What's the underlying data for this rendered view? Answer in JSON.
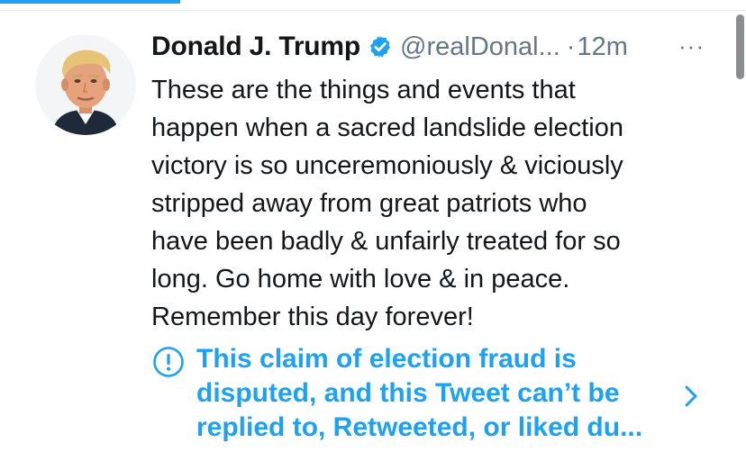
{
  "colors": {
    "accent": "#1da1f2",
    "text": "#14171a",
    "secondary_text": "#657786"
  },
  "tweet": {
    "author": {
      "display_name": "Donald J. Trump",
      "handle": "@realDonal...",
      "verified_icon": "verified-badge-icon",
      "avatar": "profile-photo"
    },
    "separator": "·",
    "timestamp": "12m",
    "more_label": "···",
    "text_lines": [
      "These are the things and events that",
      "happen when a sacred landslide election",
      "victory is so unceremoniously & viciously",
      "stripped away from great patriots who",
      "have been badly & unfairly treated for so",
      "long. Go home with love & in peace.",
      "Remember this day forever!"
    ],
    "notice": {
      "icon": "exclamation-circle-icon",
      "lines": [
        "This claim of election fraud is",
        "disputed, and this Tweet can’t be",
        "replied to, Retweeted, or liked du..."
      ],
      "chevron_icon": "chevron-right-icon"
    }
  }
}
